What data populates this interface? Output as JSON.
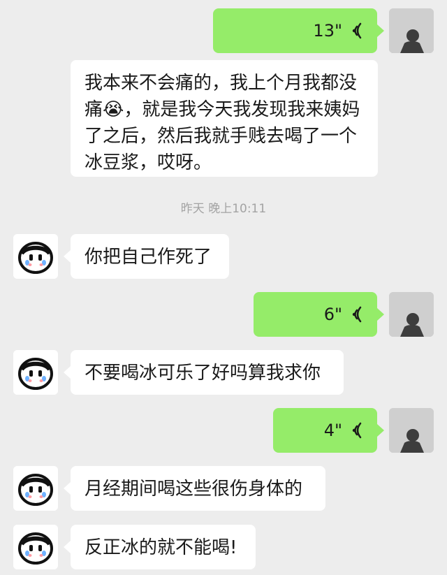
{
  "messages": [
    {
      "type": "voice",
      "side": "right",
      "duration": "13\""
    },
    {
      "type": "text",
      "side": "left",
      "text": "我本来不会痛的，我上个月我都没痛😭，就是我今天我发现我来姨妈了之后，然后我就手贱去喝了一个冰豆浆，哎呀。"
    },
    {
      "type": "time",
      "text": "昨天 晚上10:11"
    },
    {
      "type": "text",
      "side": "left",
      "text": "你把自己作死了"
    },
    {
      "type": "voice",
      "side": "right",
      "duration": "6\""
    },
    {
      "type": "text",
      "side": "left",
      "text": "不要喝冰可乐了好吗算我求你"
    },
    {
      "type": "voice",
      "side": "right",
      "duration": "4\""
    },
    {
      "type": "text",
      "side": "left",
      "text": "月经期间喝这些很伤身体的"
    },
    {
      "type": "text",
      "side": "left",
      "text": "反正冰的就不能喝!"
    }
  ],
  "icons": {
    "voice": "sound-wave-icon",
    "avatar_self": "silhouette-photo",
    "avatar_other": "crying-face"
  },
  "colors": {
    "background": "#ededed",
    "outgoing_bubble": "#95ec69",
    "incoming_bubble": "#ffffff",
    "timestamp": "#a3a3a3"
  }
}
